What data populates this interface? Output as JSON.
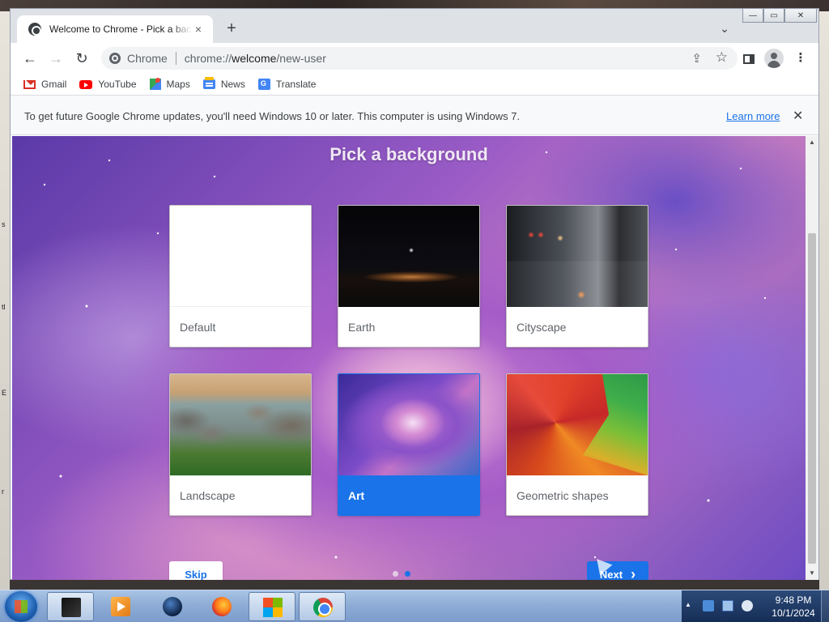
{
  "browser": {
    "tab": {
      "title": "Welcome to Chrome - Pick a background",
      "close": "×"
    },
    "new_tab": "+",
    "tab_search": "⌄",
    "window_controls": {
      "minimize": "—",
      "maximize": "▭",
      "close": "✕"
    },
    "toolbar": {
      "back": "←",
      "forward": "→",
      "reload": "↻",
      "site_chip": "Chrome",
      "url_prefix": "chrome://",
      "url_host": "welcome",
      "url_path": "/new-user",
      "share": "⇪",
      "bookmark_star": "☆",
      "menu": "⋮"
    },
    "bookmarks": [
      {
        "label": "Gmail",
        "icon": "gmail-icon"
      },
      {
        "label": "YouTube",
        "icon": "youtube-icon"
      },
      {
        "label": "Maps",
        "icon": "maps-icon"
      },
      {
        "label": "News",
        "icon": "news-icon"
      },
      {
        "label": "Translate",
        "icon": "translate-icon"
      }
    ],
    "infobar": {
      "message": "To get future Google Chrome updates, you'll need Windows 10 or later. This computer is using Windows 7.",
      "link": "Learn more",
      "close": "✕"
    }
  },
  "page": {
    "title": "Pick a background",
    "backgrounds": [
      {
        "label": "Default",
        "selected": false
      },
      {
        "label": "Earth",
        "selected": false
      },
      {
        "label": "Cityscape",
        "selected": false
      },
      {
        "label": "Landscape",
        "selected": false
      },
      {
        "label": "Art",
        "selected": true
      },
      {
        "label": "Geometric shapes",
        "selected": false
      }
    ],
    "skip": "Skip",
    "next": "Next",
    "next_chevron": "›",
    "page_dots": {
      "count": 2,
      "active": 2
    }
  },
  "scrollbar": {
    "up": "▲",
    "down": "▼"
  },
  "taskbar": {
    "apps": [
      "virtual-machine-icon",
      "media-player-icon",
      "globe-app-icon",
      "firefox-icon",
      "office-icon",
      "chrome-icon"
    ],
    "tray_chevron": "▲",
    "time": "9:48 PM",
    "date": "10/1/2024"
  },
  "colors": {
    "accent": "#1a73e8",
    "infobar_bg": "#f8f9fa",
    "taskbar": "#8eadd6"
  }
}
